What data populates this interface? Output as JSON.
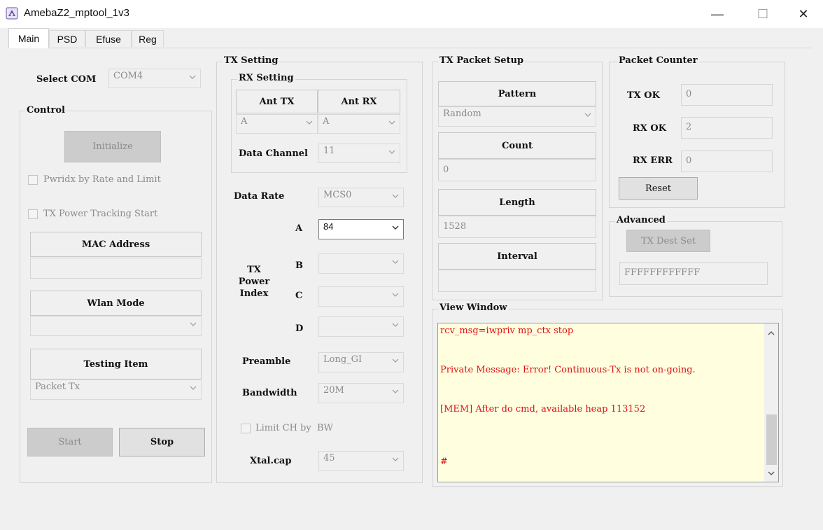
{
  "window": {
    "title": "AmebaZ2_mptool_1v3",
    "controls": [
      "—",
      "☐",
      "✕"
    ]
  },
  "tabs": [
    "Main",
    "PSD",
    "Efuse",
    "Reg"
  ],
  "select_com": {
    "label": "Select COM",
    "value": "COM4"
  },
  "control": {
    "title": "Control",
    "initialize_label": "Initialize",
    "pwridx_label": "Pwridx by Rate and Limit",
    "tracking_label": "TX Power Tracking Start",
    "mac_label": "MAC Address",
    "mac_value": "",
    "wlan_mode_label": "Wlan Mode",
    "wlan_mode_value": "",
    "testing_item_label": "Testing Item",
    "testing_item_value": "Packet Tx",
    "start_label": "Start",
    "stop_label": "Stop"
  },
  "tx_setting": {
    "title": "TX Setting",
    "rx_setting_title": "RX Setting",
    "ant_tx_label": "Ant TX",
    "ant_rx_label": "Ant RX",
    "ant_tx_value": "A",
    "ant_rx_value": "A",
    "data_channel_label": "Data Channel",
    "data_channel_value": "11",
    "data_rate_label": "Data Rate",
    "data_rate_value": "MCS0",
    "tx_power_index_label": "TX Power Index",
    "power_rows": [
      {
        "label": "A",
        "value": "84"
      },
      {
        "label": "B",
        "value": ""
      },
      {
        "label": "C",
        "value": ""
      },
      {
        "label": "D",
        "value": ""
      }
    ],
    "preamble_label": "Preamble",
    "preamble_value": "Long_GI",
    "bandwidth_label": "Bandwidth",
    "bandwidth_value": "20M",
    "limit_ch_label": "Limit CH by  BW",
    "xtal_label": "Xtal.cap",
    "xtal_value": "45"
  },
  "packet_setup": {
    "title": "TX Packet Setup",
    "pattern_label": "Pattern",
    "pattern_value": "Random",
    "count_label": "Count",
    "count_value": "0",
    "length_label": "Length",
    "length_value": "1528",
    "interval_label": "Interval",
    "interval_value": ""
  },
  "packet_counter": {
    "title": "Packet Counter",
    "tx_ok_label": "TX OK",
    "tx_ok_value": "0",
    "rx_ok_label": "RX OK",
    "rx_ok_value": "2",
    "rx_err_label": "RX ERR",
    "rx_err_value": "0",
    "reset_label": "Reset"
  },
  "advanced": {
    "title": "Advanced",
    "dest_button_label": "TX Dest Set",
    "dest_value": "FFFFFFFFFFFF"
  },
  "view_window": {
    "title": "View Window",
    "lines": [
      "rcv_msg=iwpriv mp_ctx stop",
      "Private Message: Error! Continuous-Tx is not on-going.",
      "[MEM] After do cmd, available heap 113152",
      "#"
    ]
  },
  "colors": {
    "log_text": "#e01010",
    "log_background": "#ffffe0"
  }
}
